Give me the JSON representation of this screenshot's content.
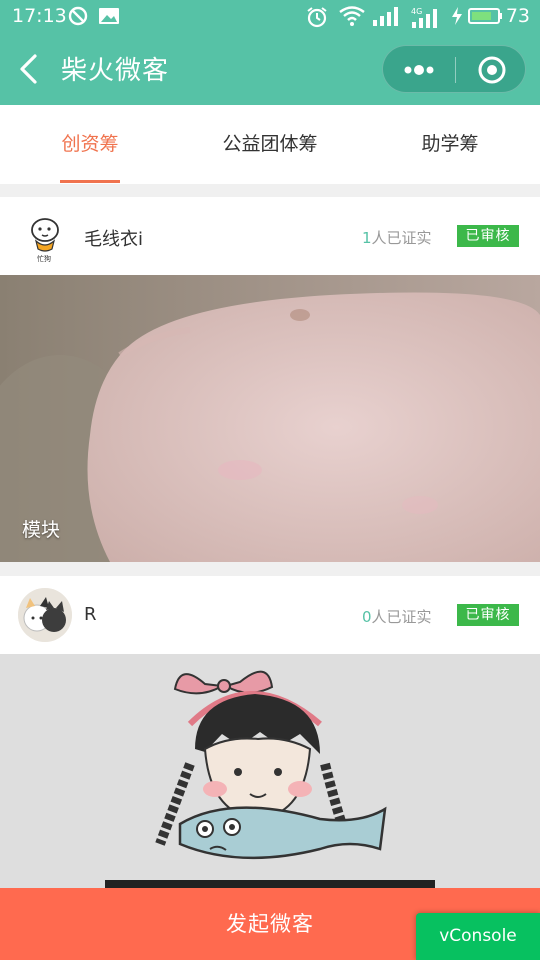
{
  "status_bar": {
    "time": "17:13",
    "battery_level": "73",
    "icons": [
      "block-icon",
      "image-icon",
      "alarm-icon",
      "wifi-icon",
      "signal-icon",
      "signal-4g-icon",
      "charging-icon",
      "battery-icon"
    ]
  },
  "nav": {
    "title": "柴火微客",
    "back_icon": "chevron-left-icon",
    "more_icon": "more-dots-icon",
    "close_icon": "target-circle-icon"
  },
  "tabs": [
    {
      "label": "创资筹",
      "active": true
    },
    {
      "label": "公益团体筹",
      "active": false
    },
    {
      "label": "助学筹",
      "active": false
    }
  ],
  "cards": [
    {
      "username": "毛线衣i",
      "verified_count": "1",
      "verified_suffix": "人已证实",
      "badge": "已审核",
      "caption": "模块",
      "avatar_label": "忙狗"
    },
    {
      "username": "R",
      "verified_count": "0",
      "verified_suffix": "人已证实",
      "badge": "已审核",
      "caption": ""
    }
  ],
  "footer": {
    "action_label": "发起微客"
  },
  "vconsole_label": "vConsole",
  "colors": {
    "brand_green": "#56c2a6",
    "accent_orange": "#f0734e",
    "footer_red": "#ff6a4f",
    "badge_green": "#3cb84a",
    "vconsole_green": "#07c160"
  }
}
